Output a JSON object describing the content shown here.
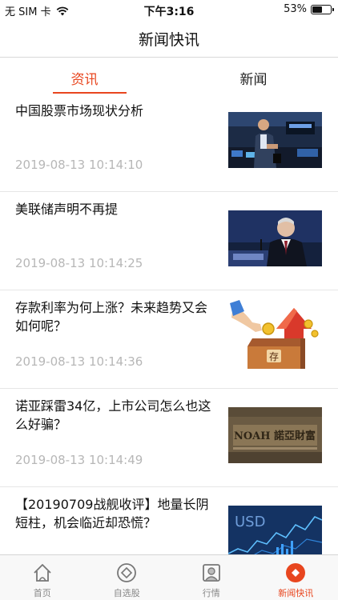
{
  "status_bar": {
    "carrier": "无 SIM 卡",
    "time": "下午3:16",
    "battery_percent": "53%",
    "battery_level": 0.53
  },
  "header": {
    "title": "新闻快讯"
  },
  "tabs": [
    {
      "label": "资讯",
      "active": true
    },
    {
      "label": "新闻",
      "active": false
    }
  ],
  "articles": [
    {
      "title": "中国股票市场现状分析",
      "time": "2019-08-13 10:14:10",
      "thumbnail": "trader-nyse-thumbnail"
    },
    {
      "title": "美联储声明不再提",
      "time": "2019-08-13 10:14:25",
      "thumbnail": "fed-chair-speech-thumbnail"
    },
    {
      "title": "存款利率为何上涨？未来趋势又会如何呢？",
      "time": "2019-08-13 10:14:36",
      "thumbnail": "deposit-box-arrow-thumbnail",
      "thumb_text": "存"
    },
    {
      "title": "诺亚踩雷34亿，上市公司怎么也这么好骗？",
      "time": "2019-08-13 10:14:49",
      "thumbnail": "noah-wealth-sign-thumbnail",
      "thumb_text": "NOAH 諾亞財富"
    },
    {
      "title": "【20190709战舰收评】地量长阴短柱，机会临近却恐慌？",
      "time": "",
      "thumbnail": "usd-chart-thumbnail",
      "thumb_text": "USD"
    }
  ],
  "tab_bar": {
    "items": [
      {
        "label": "首页",
        "icon": "home-icon",
        "active": false
      },
      {
        "label": "自选股",
        "icon": "diamond-circle-icon",
        "active": false
      },
      {
        "label": "行情",
        "icon": "market-person-icon",
        "active": false
      },
      {
        "label": "新闻快讯",
        "icon": "news-diamond-icon",
        "active": true
      }
    ]
  },
  "colors": {
    "accent": "#e8461f",
    "divider": "#e6e6e6",
    "muted_text": "#b7b7b7"
  }
}
